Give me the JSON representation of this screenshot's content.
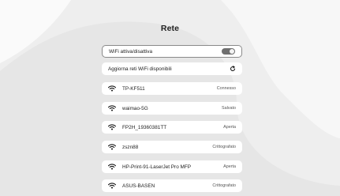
{
  "screen": {
    "title": "Rete"
  },
  "wifi_toggle": {
    "label": "WiFi attiva/disattiva",
    "enabled": true,
    "icon": "toggle-switch-icon"
  },
  "refresh": {
    "label": "Aggiorna reti WiFi disponibili",
    "icon": "refresh-icon"
  },
  "networks": [
    {
      "ssid": "TP-KF511",
      "status": "Connesso",
      "icon": "wifi-icon"
    },
    {
      "ssid": "waimao-5G",
      "status": "Salvato",
      "icon": "wifi-icon"
    },
    {
      "ssid": "FP2H_19360381TT",
      "status": "Aperta",
      "icon": "wifi-icon"
    },
    {
      "ssid": "zszn88",
      "status": "Crittografato",
      "icon": "wifi-icon"
    },
    {
      "ssid": "HP-Print-91-LaserJet Pro MFP",
      "status": "Aperta",
      "icon": "wifi-icon"
    },
    {
      "ssid": "ASUS-BASEN",
      "status": "Crittografato",
      "icon": "wifi-icon"
    }
  ],
  "colors": {
    "background": "#efefef",
    "row": "#ffffff",
    "toggle_on": "#6f6f6f",
    "text": "#222222"
  }
}
